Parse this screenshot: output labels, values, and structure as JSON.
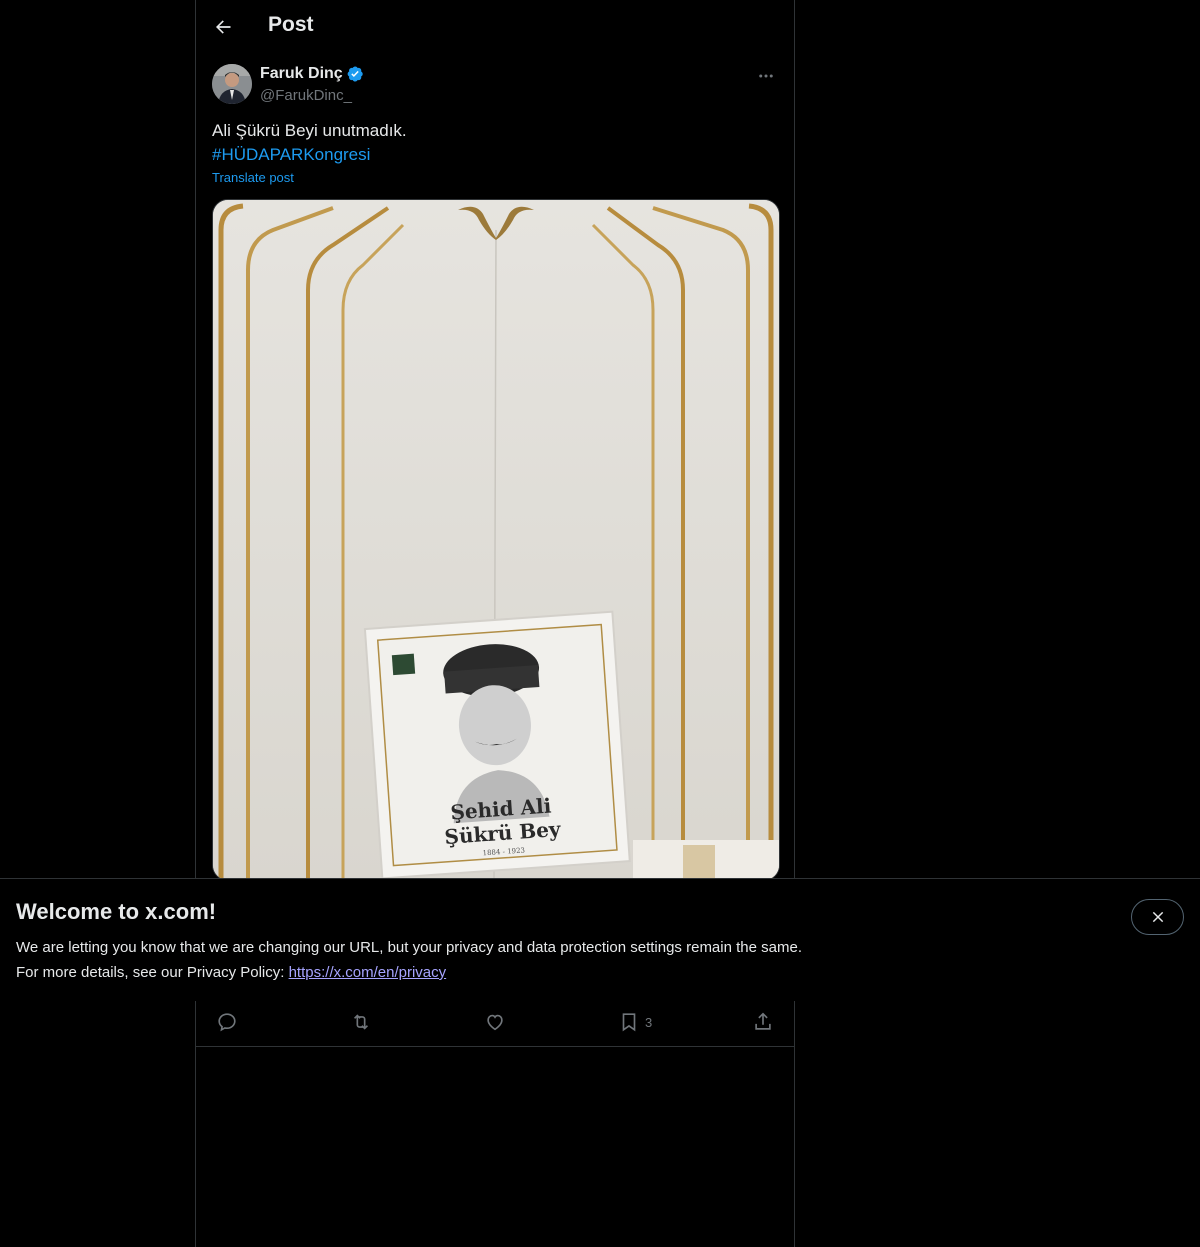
{
  "header": {
    "title": "Post",
    "back_icon": "arrow-left-icon"
  },
  "post": {
    "author": {
      "name": "Faruk Dinç",
      "handle": "@FarukDinc_",
      "verified": true,
      "verified_color": "#1d9bf0"
    },
    "text_line": "Ali Şükrü Beyi unutmadık.",
    "hashtag": "#HÜDAPARKongresi",
    "translate_label": "Translate post",
    "media": {
      "caption_line1": "Şehid Ali",
      "caption_line2": "Şükrü Bey",
      "caption_years": "1884 - 1923"
    },
    "actions": {
      "reply_icon": "reply-icon",
      "repost_icon": "repost-icon",
      "like_icon": "heart-icon",
      "bookmark_icon": "bookmark-icon",
      "bookmark_count": "3",
      "share_icon": "share-icon"
    }
  },
  "banner": {
    "title": "Welcome to x.com!",
    "line1": "We are letting you know that we are changing our URL, but your privacy and data protection settings remain the same.",
    "line2_prefix": "For more details, see our Privacy Policy: ",
    "link": "https://x.com/en/privacy"
  },
  "colors": {
    "background": "#000000",
    "accent": "#1d9bf0",
    "muted_text": "#71767b",
    "border": "#2f3336",
    "link_purple": "#a6a4ff"
  }
}
